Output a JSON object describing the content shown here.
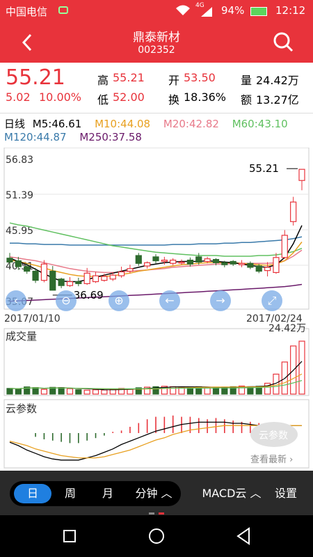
{
  "status_bar": {
    "carrier": "中国电信",
    "network": "4G",
    "battery": "94%",
    "time": "12:12"
  },
  "header": {
    "back_icon": "chevron-left-icon",
    "stock_name": "鼎泰新材",
    "stock_code": "002352",
    "search_icon": "search-icon"
  },
  "quote": {
    "price": "55.21",
    "change": "5.02",
    "change_pct": "10.00%",
    "high_label": "高",
    "high": "55.21",
    "low_label": "低",
    "low": "52.00",
    "open_label": "开",
    "open": "53.50",
    "turnover_label": "换",
    "turnover": "18.36%",
    "volume_label": "量",
    "volume": "24.42万",
    "amount_label": "额",
    "amount": "13.27亿"
  },
  "ma": {
    "kline_label": "日线",
    "m5": "M5:46.61",
    "m10": "M10:44.08",
    "m20": "M20:42.82",
    "m60": "M60:43.10",
    "m120": "M120:44.87",
    "m250": "M250:37.58"
  },
  "colors": {
    "red": "#e8333b",
    "green": "#2e6b2e",
    "m5": "#000000",
    "m10": "#e8a020",
    "m20": "#e87a8a",
    "m60": "#60c060",
    "m120": "#3a7aaa",
    "m250": "#6a1a6a",
    "tab_active": "#1f7fe0"
  },
  "chart_data": [
    {
      "type": "candlestick",
      "y_ticks": [
        "56.83",
        "51.39",
        "45.95",
        "40.51",
        "35.07"
      ],
      "ylim": [
        35.07,
        56.83
      ],
      "x_start_label": "2017/01/10",
      "x_end_label": "2017/02/24",
      "max_annotation": "55.21",
      "min_annotation": "36.69",
      "candles": [
        {
          "o": 41.6,
          "c": 41.0,
          "h": 42.4,
          "l": 40.5
        },
        {
          "o": 41.2,
          "c": 40.3,
          "h": 41.8,
          "l": 39.8
        },
        {
          "o": 40.3,
          "c": 39.6,
          "h": 40.8,
          "l": 39.2
        },
        {
          "o": 39.6,
          "c": 38.2,
          "h": 40.1,
          "l": 37.8
        },
        {
          "o": 38.2,
          "c": 40.7,
          "h": 41.3,
          "l": 37.9
        },
        {
          "o": 39.6,
          "c": 36.69,
          "h": 40.4,
          "l": 36.69
        },
        {
          "o": 38.4,
          "c": 37.4,
          "h": 38.6,
          "l": 37.0
        },
        {
          "o": 37.4,
          "c": 38.0,
          "h": 38.7,
          "l": 37.2
        },
        {
          "o": 38.0,
          "c": 37.7,
          "h": 38.6,
          "l": 37.3
        },
        {
          "o": 37.7,
          "c": 39.3,
          "h": 40.1,
          "l": 37.5
        },
        {
          "o": 38.0,
          "c": 38.9,
          "h": 39.5,
          "l": 37.8
        },
        {
          "o": 38.2,
          "c": 38.8,
          "h": 39.2,
          "l": 38.0
        },
        {
          "o": 38.4,
          "c": 39.0,
          "h": 39.4,
          "l": 38.1
        },
        {
          "o": 38.9,
          "c": 39.5,
          "h": 40.3,
          "l": 38.6
        },
        {
          "o": 39.6,
          "c": 40.0,
          "h": 40.6,
          "l": 39.3
        },
        {
          "o": 42.0,
          "c": 40.8,
          "h": 42.4,
          "l": 40.4
        },
        {
          "o": 40.4,
          "c": 40.9,
          "h": 41.1,
          "l": 40.0
        },
        {
          "o": 41.8,
          "c": 41.2,
          "h": 42.2,
          "l": 40.8
        },
        {
          "o": 41.1,
          "c": 41.3,
          "h": 41.8,
          "l": 40.6
        },
        {
          "o": 40.8,
          "c": 41.3,
          "h": 41.6,
          "l": 40.5
        },
        {
          "o": 40.9,
          "c": 41.0,
          "h": 41.4,
          "l": 40.6
        },
        {
          "o": 41.3,
          "c": 40.7,
          "h": 41.7,
          "l": 40.3
        },
        {
          "o": 41.8,
          "c": 41.0,
          "h": 42.4,
          "l": 40.6
        },
        {
          "o": 41.1,
          "c": 41.5,
          "h": 41.8,
          "l": 40.8
        },
        {
          "o": 41.4,
          "c": 40.9,
          "h": 41.6,
          "l": 40.5
        },
        {
          "o": 40.9,
          "c": 40.6,
          "h": 41.2,
          "l": 40.2
        },
        {
          "o": 41.1,
          "c": 40.7,
          "h": 41.3,
          "l": 40.4
        },
        {
          "o": 40.6,
          "c": 40.8,
          "h": 41.3,
          "l": 40.2
        },
        {
          "o": 40.8,
          "c": 40.2,
          "h": 41.1,
          "l": 39.9
        },
        {
          "o": 40.4,
          "c": 39.6,
          "h": 40.7,
          "l": 39.3
        },
        {
          "o": 39.7,
          "c": 40.2,
          "h": 41.0,
          "l": 38.8
        },
        {
          "o": 39.4,
          "c": 41.7,
          "h": 42.4,
          "l": 39.2
        },
        {
          "o": 41.7,
          "c": 45.1,
          "h": 45.9,
          "l": 41.5
        },
        {
          "o": 47.2,
          "c": 50.2,
          "h": 51.0,
          "l": 46.6
        },
        {
          "o": 53.5,
          "c": 55.21,
          "h": 55.21,
          "l": 52.0
        }
      ],
      "ma_lines": {
        "m5": [
          41.6,
          41.1,
          40.6,
          39.9,
          39.2,
          38.6,
          38.1,
          38.0,
          38.0,
          38.3,
          38.7,
          39.0,
          39.3,
          39.6,
          39.9,
          40.2,
          40.5,
          40.7,
          40.9,
          41.0,
          41.1,
          41.1,
          41.1,
          41.2,
          41.1,
          41.0,
          40.9,
          40.7,
          40.5,
          40.3,
          40.2,
          40.6,
          41.7,
          43.8,
          46.61
        ],
        "m10": [
          41.3,
          41.1,
          40.8,
          40.5,
          40.1,
          39.7,
          39.4,
          39.1,
          38.9,
          38.8,
          38.8,
          38.8,
          38.9,
          39.1,
          39.3,
          39.6,
          39.8,
          40.0,
          40.2,
          40.4,
          40.6,
          40.7,
          40.8,
          40.9,
          40.9,
          40.9,
          40.9,
          40.8,
          40.7,
          40.6,
          40.5,
          40.7,
          41.2,
          42.4,
          44.08
        ],
        "m20": [
          41.8,
          41.6,
          41.4,
          41.2,
          40.9,
          40.6,
          40.3,
          40.0,
          39.8,
          39.6,
          39.5,
          39.4,
          39.4,
          39.5,
          39.6,
          39.7,
          39.8,
          39.9,
          40.0,
          40.2,
          40.3,
          40.4,
          40.5,
          40.6,
          40.7,
          40.7,
          40.8,
          40.8,
          40.8,
          40.8,
          40.8,
          40.9,
          41.2,
          41.9,
          42.82
        ],
        "m60": [
          47.0,
          46.7,
          46.5,
          46.2,
          45.9,
          45.6,
          45.3,
          45.0,
          44.7,
          44.4,
          44.1,
          43.8,
          43.5,
          43.3,
          43.1,
          42.9,
          42.7,
          42.5,
          42.4,
          42.3,
          42.2,
          42.1,
          42.0,
          42.0,
          42.0,
          41.9,
          41.9,
          41.9,
          41.9,
          42.0,
          42.0,
          42.1,
          42.3,
          42.6,
          43.1
        ],
        "m120": [
          43.9,
          43.9,
          43.8,
          43.8,
          43.7,
          43.7,
          43.7,
          43.6,
          43.6,
          43.6,
          43.6,
          43.6,
          43.6,
          43.6,
          43.6,
          43.6,
          43.6,
          43.6,
          43.6,
          43.7,
          43.7,
          43.7,
          43.8,
          43.8,
          43.8,
          43.9,
          43.9,
          44.0,
          44.0,
          44.1,
          44.2,
          44.3,
          44.4,
          44.6,
          44.87
        ],
        "m250": [
          35.0,
          35.06,
          35.12,
          35.18,
          35.24,
          35.3,
          35.37,
          35.43,
          35.5,
          35.56,
          35.62,
          35.69,
          35.75,
          35.82,
          35.89,
          35.95,
          36.02,
          36.09,
          36.16,
          36.23,
          36.3,
          36.37,
          36.44,
          36.52,
          36.59,
          36.67,
          36.74,
          36.82,
          36.9,
          36.98,
          37.07,
          37.15,
          37.25,
          37.4,
          37.58
        ]
      }
    },
    {
      "type": "bar",
      "title": "成交量",
      "max_label": "24.42万",
      "values": [
        2.6,
        2.4,
        3.3,
        3.0,
        2.2,
        3.1,
        3.0,
        2.5,
        2.0,
        1.8,
        2.0,
        1.9,
        2.2,
        2.6,
        2.2,
        2.9,
        3.2,
        3.4,
        3.6,
        3.4,
        3.3,
        3.0,
        3.4,
        3.1,
        3.1,
        3.2,
        3.4,
        3.7,
        3.4,
        3.6,
        5.0,
        9.2,
        14.8,
        22.2,
        24.42
      ],
      "up": [
        false,
        false,
        false,
        false,
        true,
        false,
        false,
        true,
        false,
        true,
        true,
        true,
        true,
        true,
        true,
        false,
        true,
        false,
        true,
        true,
        true,
        false,
        false,
        true,
        false,
        false,
        false,
        true,
        false,
        false,
        true,
        true,
        true,
        true,
        true
      ]
    },
    {
      "type": "macd",
      "title": "云参数",
      "cloud_label": "云参数",
      "more_label": "查看最新",
      "hist": [
        0,
        0,
        0,
        -0.3,
        -0.5,
        -0.6,
        -0.7,
        -0.8,
        -0.8,
        -0.6,
        -0.4,
        -0.2,
        0.1,
        0.2,
        0.5,
        0.8,
        1.1,
        1.3,
        1.3,
        1.4,
        1.3,
        1.3,
        1.2,
        1.1,
        1.2,
        1.1,
        1.0,
        0.9,
        0.9,
        0.8,
        0.6,
        0.5,
        0,
        0,
        0
      ],
      "dif": [
        -0.2,
        -0.5,
        -0.9,
        -1.2,
        -1.5,
        -1.7,
        -1.8,
        -1.8,
        -1.8,
        -1.6,
        -1.4,
        -1.1,
        -0.8,
        -0.4,
        -0.1,
        0.2,
        0.5,
        0.8,
        1.0,
        1.2,
        1.4,
        1.5,
        1.6,
        1.6,
        1.6,
        1.6,
        1.5,
        1.5,
        1.4,
        1.3,
        1.3,
        1.3,
        1.3,
        1.3,
        1.3
      ],
      "dea": [
        -0.1,
        -0.3,
        -0.5,
        -0.8,
        -1.0,
        -1.2,
        -1.4,
        -1.5,
        -1.6,
        -1.6,
        -1.6,
        -1.5,
        -1.3,
        -1.1,
        -0.9,
        -0.6,
        -0.3,
        0.0,
        0.2,
        0.5,
        0.7,
        0.9,
        1.0,
        1.1,
        1.2,
        1.3,
        1.3,
        1.3,
        1.3,
        1.3,
        1.3,
        1.3,
        1.3,
        1.3,
        1.3
      ]
    }
  ],
  "zoom_controls": [
    "zoom-out-icon",
    "zoom-in-icon",
    "arrow-left-icon",
    "arrow-right-icon",
    "fullscreen-icon"
  ],
  "tabs": {
    "day": "日",
    "week": "周",
    "month": "月",
    "minute": "分钟",
    "indicator": "MACD云",
    "settings": "设置"
  },
  "nav": [
    "recent-apps-icon",
    "home-icon",
    "back-icon"
  ]
}
